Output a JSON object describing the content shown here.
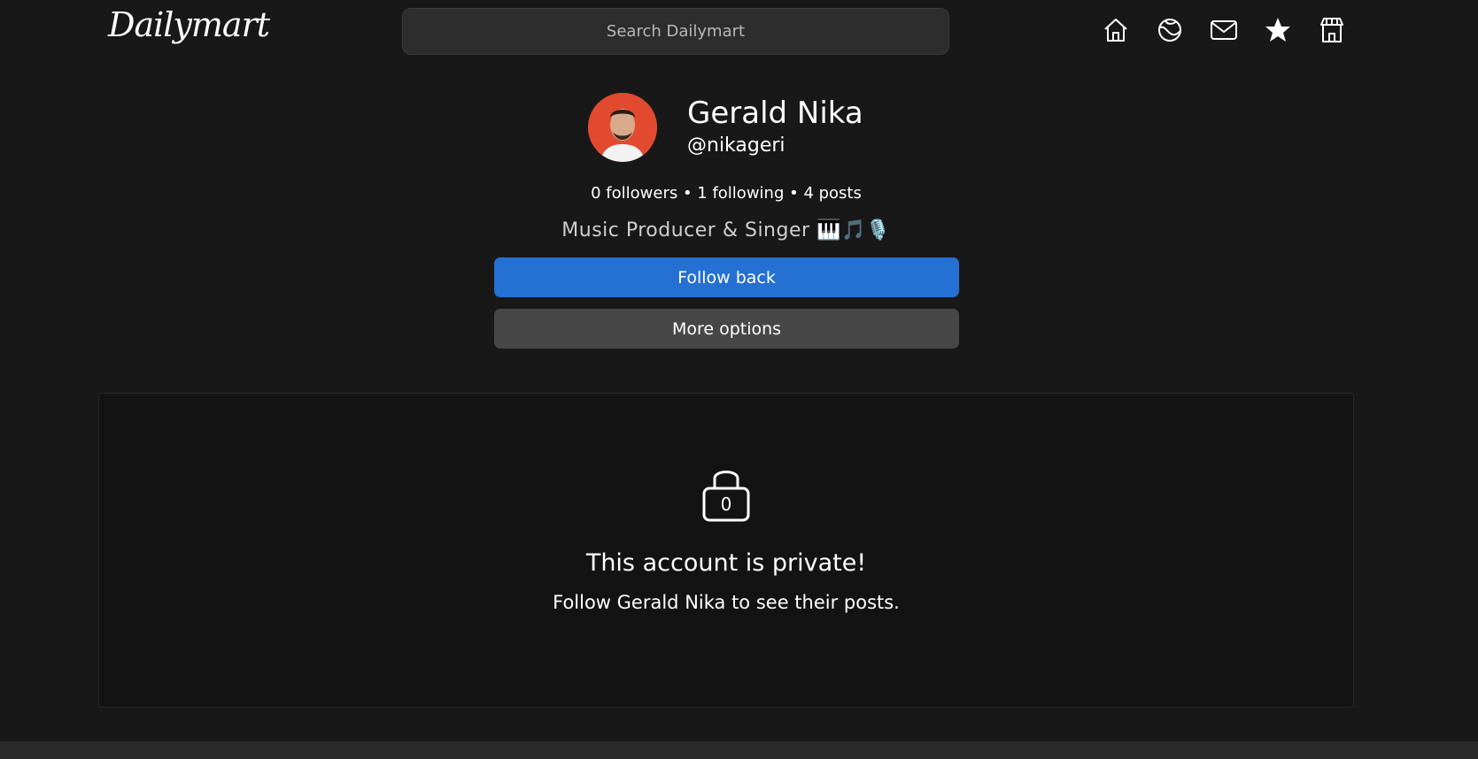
{
  "header": {
    "logo": "Dailymart",
    "search_placeholder": "Search Dailymart",
    "nav_icons": [
      "home-icon",
      "explore-icon",
      "mail-icon",
      "star-icon",
      "store-icon"
    ]
  },
  "profile": {
    "name": "Gerald Nika",
    "handle": "@nikageri",
    "stats": "0  followers • 1 following • 4 posts",
    "bio_text": "Music Producer & Singer ",
    "bio_emoji": "🎹🎵🎙️",
    "follow_label": "Follow back",
    "more_label": "More options"
  },
  "private_notice": {
    "lock_number": "0",
    "title": "This account is private!",
    "subtitle": "Follow Gerald Nika to see their posts."
  },
  "colors": {
    "background": "#181818",
    "accent": "#2470d3",
    "secondary_button": "#474747",
    "avatar_bg": "#e24a2f"
  }
}
